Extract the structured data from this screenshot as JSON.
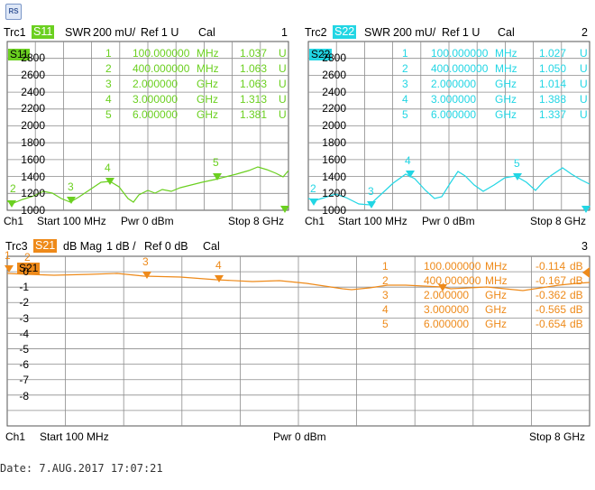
{
  "logo": {
    "text": "RS",
    "icon": "rohde-schwarz-logo-icon"
  },
  "colors": {
    "trc1": "#6bd020",
    "trc2": "#22d6e4",
    "trc3": "#ee8a1a",
    "grid": "#8c8c8c"
  },
  "trc1": {
    "trace_label": "Trc1",
    "param": "S11",
    "format": "SWR",
    "scale": "200 mU/",
    "ref": "Ref 1 U",
    "cal": "Cal",
    "window_number": "1",
    "badge": "S11",
    "y_ticks": [
      "2800",
      "2600",
      "2400",
      "2200",
      "2000",
      "1800",
      "1600",
      "1400",
      "1200",
      "1000"
    ],
    "markers": [
      {
        "num": "1",
        "value": "100.000000",
        "unit": "MHz",
        "reading": "1.037",
        "runit": "U"
      },
      {
        "num": "2",
        "value": "400.000000",
        "unit": "MHz",
        "reading": "1.063",
        "runit": "U"
      },
      {
        "num": "3",
        "value": "2.000000",
        "unit": "GHz",
        "reading": "1.063",
        "runit": "U"
      },
      {
        "num": "4",
        "value": "3.000000",
        "unit": "GHz",
        "reading": "1.313",
        "runit": "U"
      },
      {
        "num": "5",
        "value": "6.000000",
        "unit": "GHz",
        "reading": "1.381",
        "runit": "U"
      }
    ],
    "channel": "Ch1",
    "start": "Start  100 MHz",
    "pwr": "Pwr  0 dBm",
    "stop": "Stop  8 GHz"
  },
  "trc2": {
    "trace_label": "Trc2",
    "param": "S22",
    "format": "SWR",
    "scale": "200 mU/",
    "ref": "Ref 1 U",
    "cal": "Cal",
    "window_number": "2",
    "badge": "S22",
    "y_ticks": [
      "2800",
      "2600",
      "2400",
      "2200",
      "2000",
      "1800",
      "1600",
      "1400",
      "1200",
      "1000"
    ],
    "markers": [
      {
        "num": "1",
        "value": "100.000000",
        "unit": "MHz",
        "reading": "1.027",
        "runit": "U"
      },
      {
        "num": "2",
        "value": "400.000000",
        "unit": "MHz",
        "reading": "1.050",
        "runit": "U"
      },
      {
        "num": "3",
        "value": "2.000000",
        "unit": "GHz",
        "reading": "1.014",
        "runit": "U"
      },
      {
        "num": "4",
        "value": "3.000000",
        "unit": "GHz",
        "reading": "1.388",
        "runit": "U"
      },
      {
        "num": "5",
        "value": "6.000000",
        "unit": "GHz",
        "reading": "1.337",
        "runit": "U"
      }
    ],
    "channel": "Ch1",
    "start": "Start  100 MHz",
    "pwr": "Pwr  0 dBm",
    "stop": "Stop  8 GHz"
  },
  "trc3": {
    "trace_label": "Trc3",
    "param": "S21",
    "format": "dB Mag",
    "scale": "1 dB /",
    "ref": "Ref 0 dB",
    "cal": "Cal",
    "window_number": "3",
    "badge": "S21",
    "y_ticks": [
      "0",
      "-1",
      "-2",
      "-3",
      "-4",
      "-5",
      "-6",
      "-7",
      "-8"
    ],
    "markers": [
      {
        "num": "1",
        "value": "100.000000",
        "unit": "MHz",
        "reading": "-0.114",
        "runit": "dB"
      },
      {
        "num": "2",
        "value": "400.000000",
        "unit": "MHz",
        "reading": "-0.167",
        "runit": "dB"
      },
      {
        "num": "3",
        "value": "2.000000",
        "unit": "GHz",
        "reading": "-0.362",
        "runit": "dB"
      },
      {
        "num": "4",
        "value": "3.000000",
        "unit": "GHz",
        "reading": "-0.565",
        "runit": "dB"
      },
      {
        "num": "5",
        "value": "6.000000",
        "unit": "GHz",
        "reading": "-0.654",
        "runit": "dB"
      }
    ],
    "channel": "Ch1",
    "start": "Start  100 MHz",
    "pwr": "Pwr  0 dBm",
    "stop": "Stop  8 GHz"
  },
  "footer": {
    "date": "Date: 7.AUG.2017   17:07:21"
  }
}
